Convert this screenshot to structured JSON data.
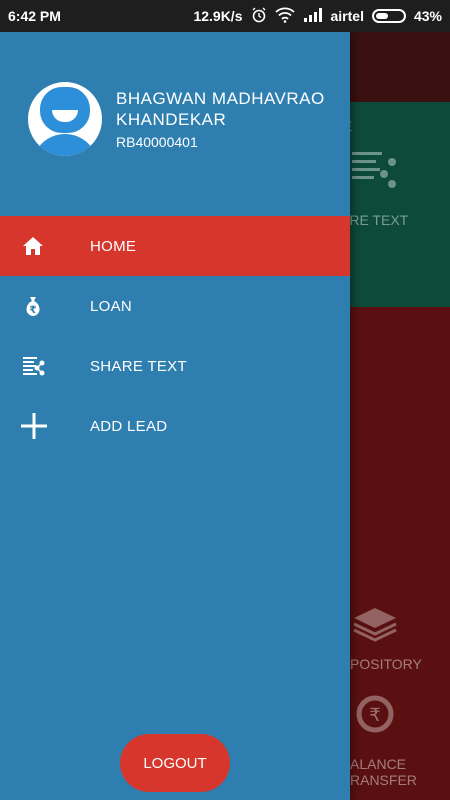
{
  "status_bar": {
    "time": "6:42 PM",
    "network_speed": "12.9K/s",
    "carrier": "airtel",
    "battery": "43%",
    "icons": [
      "alarm-icon",
      "wifi-icon",
      "signal-icon",
      "battery-icon"
    ]
  },
  "profile": {
    "name": "BHAGWAN MADHAVRAO KHANDEKAR",
    "id": "RB40000401"
  },
  "menu": [
    {
      "label": "HOME",
      "icon": "home-icon",
      "active": true
    },
    {
      "label": "LOAN",
      "icon": "rupee-bag-icon",
      "active": false
    },
    {
      "label": "SHARE TEXT",
      "icon": "share-text-icon",
      "active": false
    },
    {
      "label": "ADD LEAD",
      "icon": "plus-icon",
      "active": false
    }
  ],
  "logout_label": "LOGOUT",
  "background": {
    "tile1_label": "RAMME",
    "tile2_label": "ARE TEXT",
    "tile3_label": "POSITORY",
    "tile4_label_line1": "ALANCE",
    "tile4_label_line2": "RANSFER"
  },
  "colors": {
    "drawer": "#2e7fb0",
    "active": "#d6362c",
    "status_bar": "#1e1e1e"
  }
}
